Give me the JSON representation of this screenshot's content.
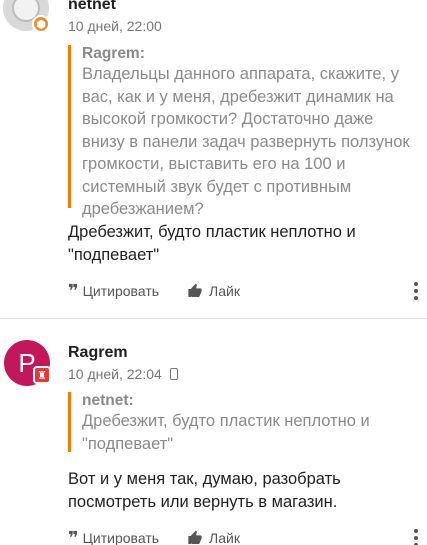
{
  "posts": [
    {
      "author": "netnet",
      "meta": "10 дней, 22:00",
      "quote": {
        "author": "Ragrem:",
        "text": "Владельцы данного аппарата, скажите, у вас, как и у меня, дребезжит динамик на высокой громкости? Достаточно даже внизу в панели задач развернуть ползунок громкости, выставить его на 100 и системный звук будет с противным дребезжанием?"
      },
      "body": "Дребезжит, будто пластик неплотно и \"подпевает\"",
      "actions": {
        "cite": "Цитировать",
        "like": "Лайк"
      }
    },
    {
      "author": "Ragrem",
      "avatar_letter": "P",
      "meta": "10 дней, 22:04",
      "quote": {
        "author": "netnet:",
        "text": "Дребезжит, будто пластик неплотно и \"подпевает\""
      },
      "body": "Вот и у меня так, думаю, разобрать посмотреть или вернуть в магазин.",
      "actions": {
        "cite": "Цитировать",
        "like": "Лайк"
      }
    }
  ],
  "colors": {
    "quote_bar": "#f57c00",
    "avatar_ragrem": "#c2185b",
    "badge_orange": "#e8912d",
    "badge_red": "#e53935"
  },
  "icons": {
    "cite": "quote-icon",
    "like": "thumbs-up-icon",
    "more": "more-vertical-icon",
    "device": "phone-icon"
  }
}
